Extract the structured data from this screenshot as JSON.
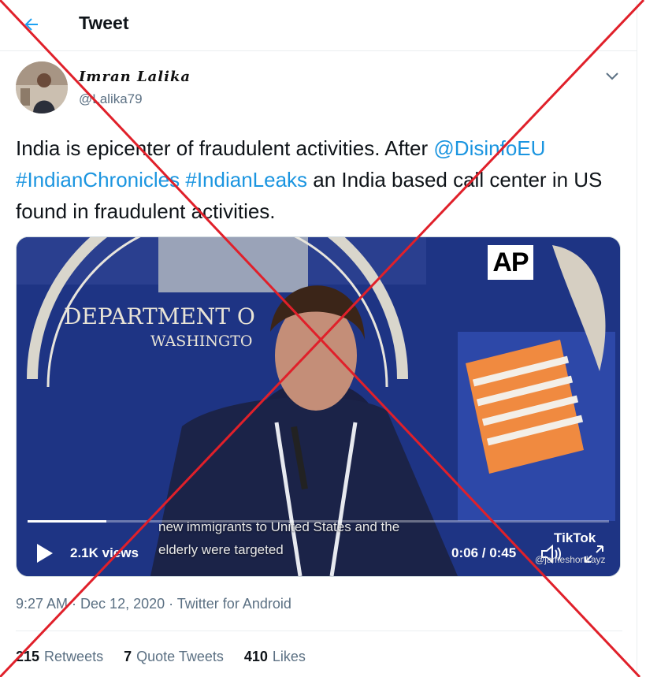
{
  "header": {
    "title": "Tweet"
  },
  "author": {
    "display_name": "Imran Lalika",
    "handle": "@Lalika79"
  },
  "tweet": {
    "text_1": "India is epicenter of fraudulent activities. After ",
    "mention": "@DisinfoEU",
    "hashtag_1": "#IndianChronicles",
    "hashtag_2": "#IndianLeaks",
    "text_2": " an India based call center in US found in fraudulent activities."
  },
  "video": {
    "sign_line_1": "DEPARTMENT O",
    "sign_line_2": "WASHINGTO",
    "ap_logo": "AP",
    "subtitle_line_1": "new immigrants to United States and the",
    "subtitle_line_2": "elderly were targeted",
    "views": "2.1K views",
    "timecode": "0:06 / 0:45",
    "progress": 0.135,
    "watermark": "TikTok",
    "watermark_handle": "@jameshortkayz"
  },
  "meta": {
    "time": "9:27 AM",
    "date": "Dec 12, 2020",
    "source": "Twitter for Android",
    "sep": " · "
  },
  "stats": {
    "retweets_count": "215",
    "retweets_label": "Retweets",
    "quotes_count": "7",
    "quotes_label": "Quote Tweets",
    "likes_count": "410",
    "likes_label": "Likes"
  },
  "colors": {
    "link": "#1b95e0",
    "cross": "#e0202a",
    "muted": "#5b7083"
  },
  "icons": [
    "back-arrow-icon",
    "chevron-down-icon",
    "play-icon",
    "volume-icon",
    "fullscreen-icon"
  ]
}
